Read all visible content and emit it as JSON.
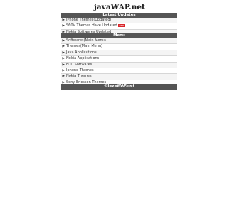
{
  "site": {
    "title": "javaWAP.net"
  },
  "latest": {
    "header": "Latest Updates",
    "items": [
      {
        "label": "iPhone Themes(Updated)",
        "badge": ""
      },
      {
        "label": "S60V Themes Have Updated",
        "badge": "new"
      },
      {
        "label": "Nokia Softwares Updated",
        "badge": ""
      }
    ]
  },
  "menu": {
    "header": "Menu",
    "items": [
      {
        "label": "Softwares(Main Menu)"
      },
      {
        "label": "Themes(Main Menu)"
      },
      {
        "label": "Java Applications"
      },
      {
        "label": "Nokia Applications"
      },
      {
        "label": "HTC Softwares"
      },
      {
        "label": "Iphone Themes"
      },
      {
        "label": "Nokia Themes"
      },
      {
        "label": "Sony Ericsson Themes"
      }
    ]
  },
  "footer": {
    "label": "©JavaWAP.net"
  },
  "icons": {
    "bullet": "arrow-right-icon"
  }
}
